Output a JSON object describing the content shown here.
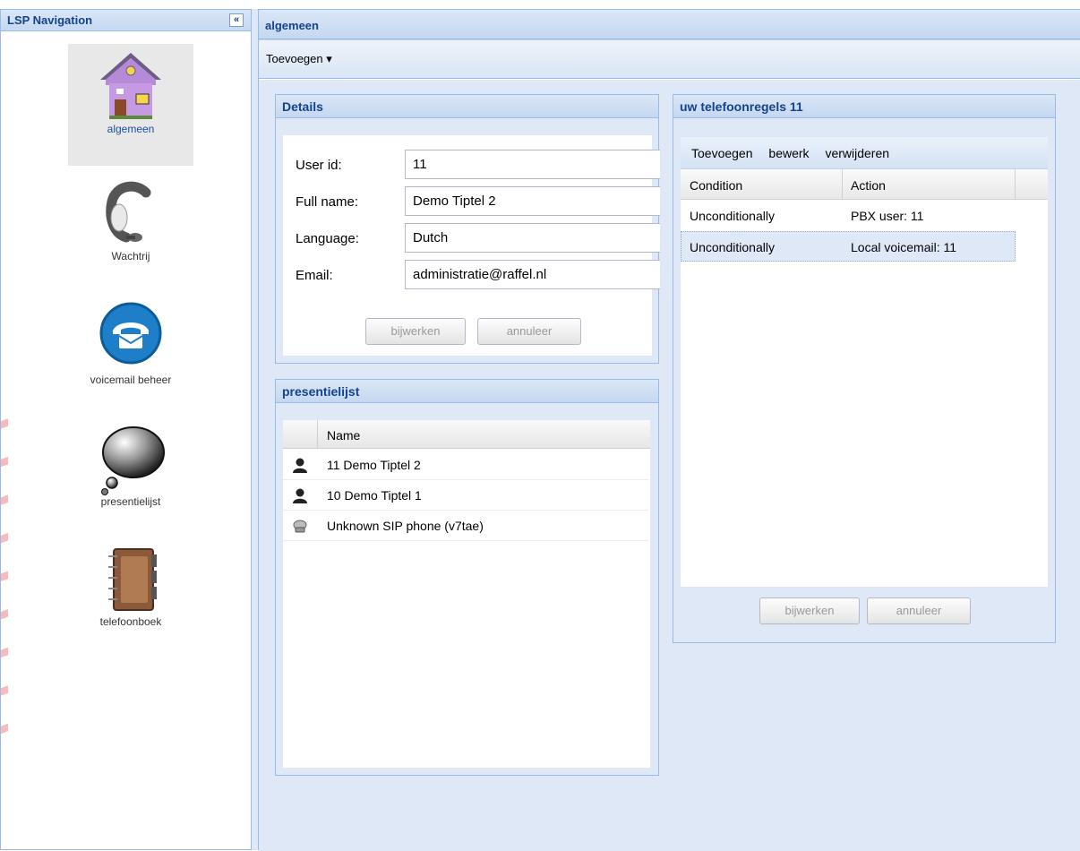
{
  "nav": {
    "title": "LSP Navigation",
    "collapse_glyph": "«",
    "items": [
      {
        "label": "algemeen",
        "icon": "house-icon",
        "selected": true
      },
      {
        "label": "Wachtrij",
        "icon": "headset-icon",
        "selected": false
      },
      {
        "label": "voicemail beheer",
        "icon": "phone-icon",
        "selected": false
      },
      {
        "label": "presentielijst",
        "icon": "speech-bubble-icon",
        "selected": false
      },
      {
        "label": "telefoonboek",
        "icon": "address-book-icon",
        "selected": false
      }
    ]
  },
  "main": {
    "title": "algemeen",
    "toolbar": {
      "add_menu": "Toevoegen ▾"
    }
  },
  "details": {
    "title": "Details",
    "fields": [
      {
        "label": "User id:",
        "value": "11"
      },
      {
        "label": "Full name:",
        "value": "Demo Tiptel 2"
      },
      {
        "label": "Language:",
        "value": "Dutch"
      },
      {
        "label": "Email:",
        "value": "administratie@raffel.nl"
      }
    ],
    "update_label": "bijwerken",
    "cancel_label": "annuleer"
  },
  "presence": {
    "title": "presentielijst",
    "column_name": "Name",
    "rows": [
      {
        "icon": "user-icon",
        "name": "11 Demo Tiptel 2"
      },
      {
        "icon": "user-icon",
        "name": "10 Demo Tiptel 1"
      },
      {
        "icon": "sip-phone-icon",
        "name": "Unknown SIP phone (v7tae)"
      }
    ]
  },
  "rules": {
    "title": "uw telefoonregels 11",
    "tool_add": "Toevoegen",
    "tool_edit": "bewerk",
    "tool_delete": "verwijderen",
    "col_condition": "Condition",
    "col_action": "Action",
    "rows": [
      {
        "condition": "Unconditionally",
        "action": "PBX user: 11",
        "selected": false
      },
      {
        "condition": "Unconditionally",
        "action": "Local voicemail: 11",
        "selected": true
      }
    ],
    "update_label": "bijwerken",
    "cancel_label": "annuleer"
  }
}
